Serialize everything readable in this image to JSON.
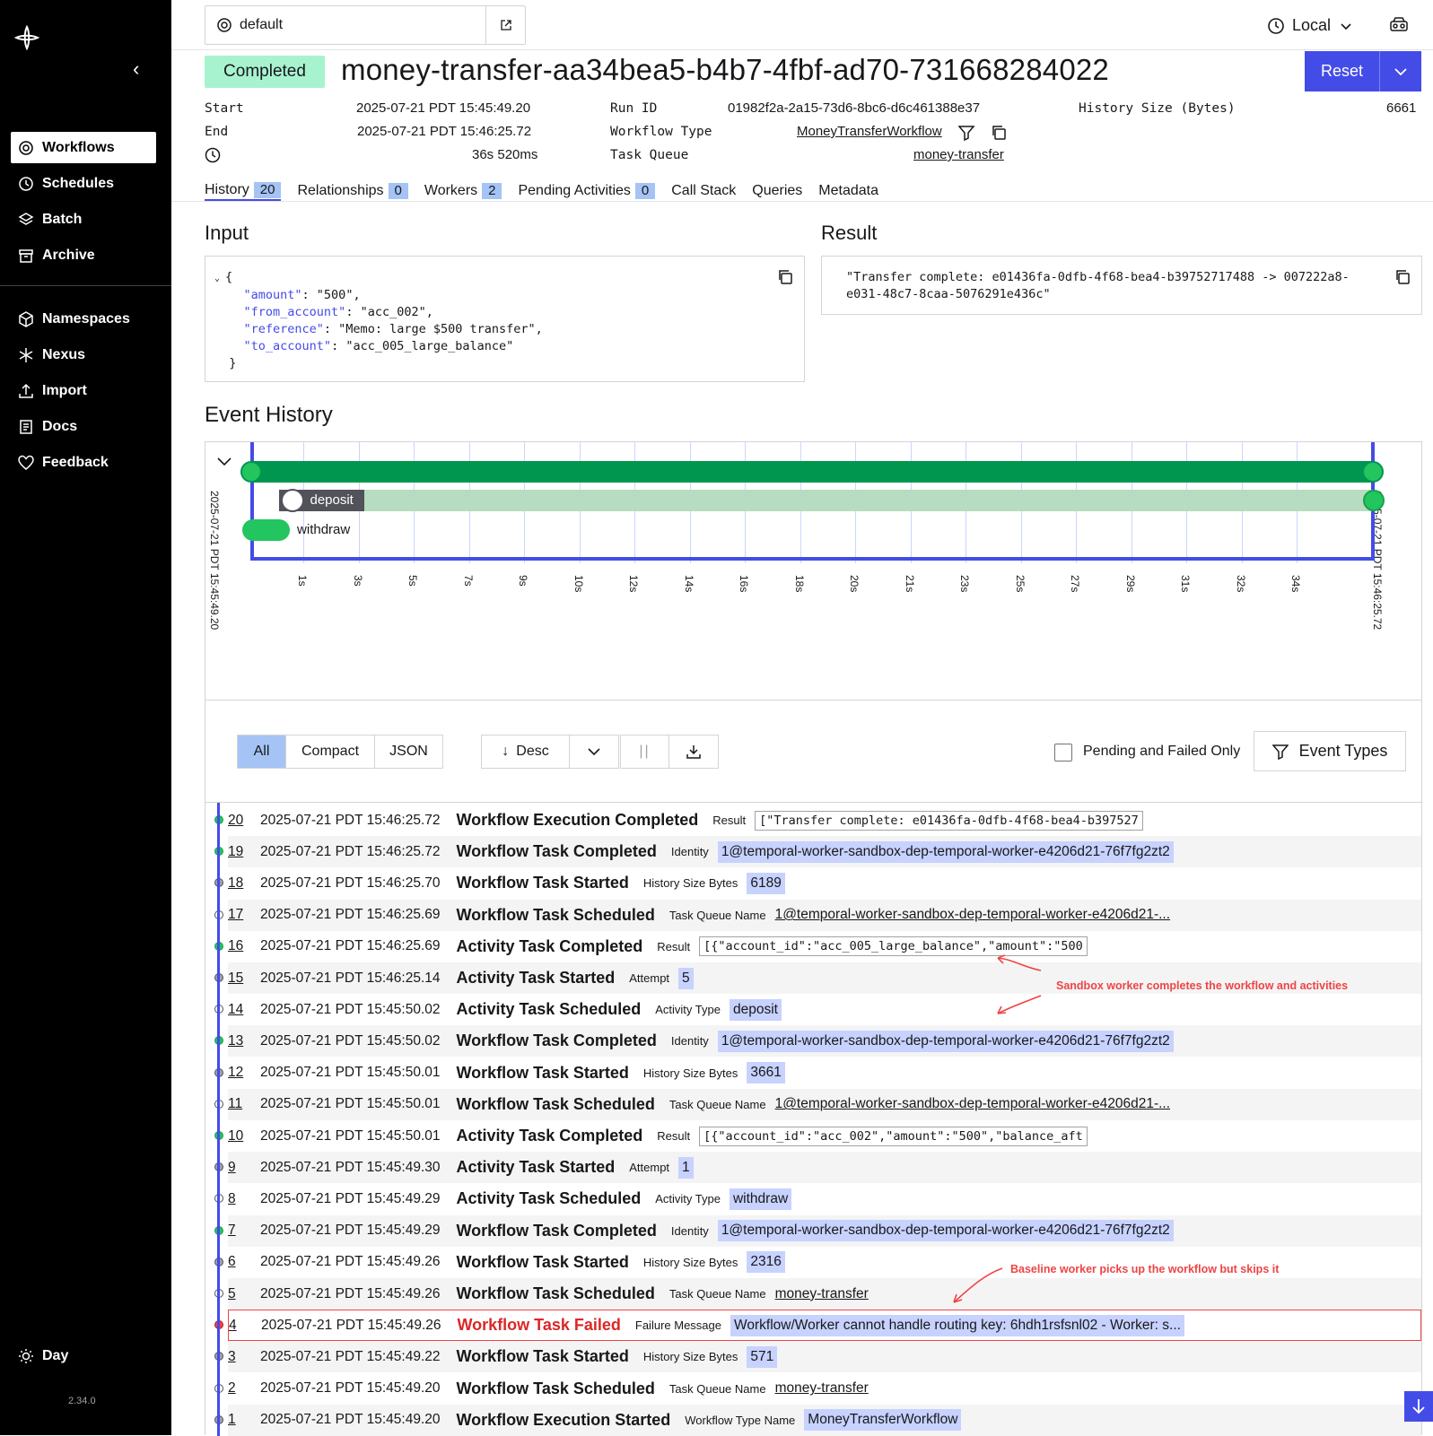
{
  "sidebar": {
    "items": [
      {
        "label": "Workflows",
        "icon": "workflows-icon"
      },
      {
        "label": "Schedules",
        "icon": "schedules-icon"
      },
      {
        "label": "Batch",
        "icon": "batch-icon"
      },
      {
        "label": "Archive",
        "icon": "archive-icon"
      },
      {
        "label": "Namespaces",
        "icon": "namespaces-icon"
      },
      {
        "label": "Nexus",
        "icon": "nexus-icon"
      },
      {
        "label": "Import",
        "icon": "import-icon"
      },
      {
        "label": "Docs",
        "icon": "docs-icon"
      },
      {
        "label": "Feedback",
        "icon": "heart-icon"
      }
    ],
    "theme_label": "Day",
    "version": "2.34.0"
  },
  "topbar": {
    "namespace": "default",
    "timezone": "Local"
  },
  "header": {
    "status": "Completed",
    "title": "money-transfer-aa34bea5-b4b7-4fbf-ad70-731668284022",
    "reset_label": "Reset"
  },
  "summary": {
    "start_label": "Start",
    "start": "2025-07-21 PDT 15:45:49.20",
    "end_label": "End",
    "end": "2025-07-21 PDT 15:46:25.72",
    "duration": "36s 520ms",
    "run_id_label": "Run ID",
    "run_id": "01982f2a-2a15-73d6-8bc6-d6c461388e37",
    "workflow_type_label": "Workflow Type",
    "workflow_type": "MoneyTransferWorkflow",
    "task_queue_label": "Task Queue",
    "task_queue": "money-transfer",
    "history_size_label": "History Size (Bytes)",
    "history_size": "6661"
  },
  "tabs": [
    {
      "label": "History",
      "count": "20"
    },
    {
      "label": "Relationships",
      "count": "0"
    },
    {
      "label": "Workers",
      "count": "2"
    },
    {
      "label": "Pending Activities",
      "count": "0"
    },
    {
      "label": "Call Stack"
    },
    {
      "label": "Queries"
    },
    {
      "label": "Metadata"
    }
  ],
  "input": {
    "title": "Input",
    "open": "{",
    "close": "}",
    "fields": [
      {
        "key": "\"amount\"",
        "value": ": \"500\","
      },
      {
        "key": "\"from_account\"",
        "value": ": \"acc_002\","
      },
      {
        "key": "\"reference\"",
        "value": ": \"Memo: large $500 transfer\","
      },
      {
        "key": "\"to_account\"",
        "value": ": \"acc_005_large_balance\""
      }
    ]
  },
  "result": {
    "title": "Result",
    "value": "\"Transfer complete: e01436fa-0dfb-4f68-bea4-b39752717488 -> 007222a8-e031-48c7-8caa-5076291e436c\""
  },
  "event_history": {
    "title": "Event History",
    "timeline": {
      "start_label": "2025-07-21 PDT 15:45:49.20",
      "end_label": "2025-07-21 PDT 15:46:25.72",
      "ticks": [
        "1s",
        "3s",
        "5s",
        "7s",
        "9s",
        "10s",
        "12s",
        "14s",
        "16s",
        "18s",
        "20s",
        "21s",
        "23s",
        "25s",
        "27s",
        "29s",
        "31s",
        "32s",
        "34s"
      ],
      "activities": [
        {
          "name": "deposit",
          "start_s": 0.95,
          "end_s": 36.5
        },
        {
          "name": "withdraw",
          "start_s": 0.09,
          "end_s": 0.82
        }
      ],
      "workflow_span_s": [
        0,
        36.52
      ]
    },
    "view_modes": [
      "All",
      "Compact",
      "JSON"
    ],
    "active_view": "All",
    "sort_label": "Desc",
    "pending_failed_label": "Pending and Failed Only",
    "event_types_label": "Event Types",
    "events": [
      {
        "id": "20",
        "time": "2025-07-21 PDT 15:46:25.72",
        "type": "Workflow Execution Completed",
        "label": "Result",
        "value": "[\"Transfer complete: e01436fa-0dfb-4f68-bea4-b397527",
        "style": "code",
        "dot": "green"
      },
      {
        "id": "19",
        "time": "2025-07-21 PDT 15:46:25.72",
        "type": "Workflow Task Completed",
        "label": "Identity",
        "value": "1@temporal-worker-sandbox-dep-temporal-worker-e4206d21-76f7fg2zt2",
        "style": "chip",
        "dot": "green"
      },
      {
        "id": "18",
        "time": "2025-07-21 PDT 15:46:25.70",
        "type": "Workflow Task Started",
        "label": "History Size Bytes",
        "value": "6189",
        "style": "chip",
        "dot": "gray"
      },
      {
        "id": "17",
        "time": "2025-07-21 PDT 15:46:25.69",
        "type": "Workflow Task Scheduled",
        "label": "Task Queue Name",
        "value": "1@temporal-worker-sandbox-dep-temporal-worker-e4206d21-...",
        "style": "link",
        "dot": "white"
      },
      {
        "id": "16",
        "time": "2025-07-21 PDT 15:46:25.69",
        "type": "Activity Task Completed",
        "label": "Result",
        "value": "[{\"account_id\":\"acc_005_large_balance\",\"amount\":\"500",
        "style": "code",
        "dot": "green"
      },
      {
        "id": "15",
        "time": "2025-07-21 PDT 15:46:25.14",
        "type": "Activity Task Started",
        "label": "Attempt",
        "value": "5",
        "style": "chip",
        "dot": "gray"
      },
      {
        "id": "14",
        "time": "2025-07-21 PDT 15:45:50.02",
        "type": "Activity Task Scheduled",
        "label": "Activity Type",
        "value": "deposit",
        "style": "chip",
        "dot": "white"
      },
      {
        "id": "13",
        "time": "2025-07-21 PDT 15:45:50.02",
        "type": "Workflow Task Completed",
        "label": "Identity",
        "value": "1@temporal-worker-sandbox-dep-temporal-worker-e4206d21-76f7fg2zt2",
        "style": "chip",
        "dot": "green"
      },
      {
        "id": "12",
        "time": "2025-07-21 PDT 15:45:50.01",
        "type": "Workflow Task Started",
        "label": "History Size Bytes",
        "value": "3661",
        "style": "chip",
        "dot": "gray"
      },
      {
        "id": "11",
        "time": "2025-07-21 PDT 15:45:50.01",
        "type": "Workflow Task Scheduled",
        "label": "Task Queue Name",
        "value": "1@temporal-worker-sandbox-dep-temporal-worker-e4206d21-...",
        "style": "link",
        "dot": "white"
      },
      {
        "id": "10",
        "time": "2025-07-21 PDT 15:45:50.01",
        "type": "Activity Task Completed",
        "label": "Result",
        "value": "[{\"account_id\":\"acc_002\",\"amount\":\"500\",\"balance_aft",
        "style": "code",
        "dot": "green"
      },
      {
        "id": "9",
        "time": "2025-07-21 PDT 15:45:49.30",
        "type": "Activity Task Started",
        "label": "Attempt",
        "value": "1",
        "style": "chip",
        "dot": "gray"
      },
      {
        "id": "8",
        "time": "2025-07-21 PDT 15:45:49.29",
        "type": "Activity Task Scheduled",
        "label": "Activity Type",
        "value": "withdraw",
        "style": "chip",
        "dot": "white"
      },
      {
        "id": "7",
        "time": "2025-07-21 PDT 15:45:49.29",
        "type": "Workflow Task Completed",
        "label": "Identity",
        "value": "1@temporal-worker-sandbox-dep-temporal-worker-e4206d21-76f7fg2zt2",
        "style": "chip",
        "dot": "green"
      },
      {
        "id": "6",
        "time": "2025-07-21 PDT 15:45:49.26",
        "type": "Workflow Task Started",
        "label": "History Size Bytes",
        "value": "2316",
        "style": "chip",
        "dot": "gray"
      },
      {
        "id": "5",
        "time": "2025-07-21 PDT 15:45:49.26",
        "type": "Workflow Task Scheduled",
        "label": "Task Queue Name",
        "value": "money-transfer",
        "style": "link",
        "dot": "white"
      },
      {
        "id": "4",
        "time": "2025-07-21 PDT 15:45:49.26",
        "type": "Workflow Task Failed",
        "label": "Failure Message",
        "value": "Workflow/Worker cannot handle routing key: 6hdh1rsfsnl02 - Worker: s...",
        "style": "chip",
        "dot": "red"
      },
      {
        "id": "3",
        "time": "2025-07-21 PDT 15:45:49.22",
        "type": "Workflow Task Started",
        "label": "History Size Bytes",
        "value": "571",
        "style": "chip",
        "dot": "gray"
      },
      {
        "id": "2",
        "time": "2025-07-21 PDT 15:45:49.20",
        "type": "Workflow Task Scheduled",
        "label": "Task Queue Name",
        "value": "money-transfer",
        "style": "link",
        "dot": "white"
      },
      {
        "id": "1",
        "time": "2025-07-21 PDT 15:45:49.20",
        "type": "Workflow Execution Started",
        "label": "Workflow Type Name",
        "value": "MoneyTransferWorkflow",
        "style": "chip",
        "dot": "gray"
      }
    ]
  },
  "annotations": {
    "sandbox_note": "Sandbox worker completes the workflow and activities",
    "baseline_note": "Baseline worker picks up the workflow but skips it"
  },
  "colors": {
    "accent": "#444ce7",
    "success": "#00964f",
    "badge": "#a7f3d0",
    "chip": "#c7d2fe",
    "error": "#dc2626"
  }
}
